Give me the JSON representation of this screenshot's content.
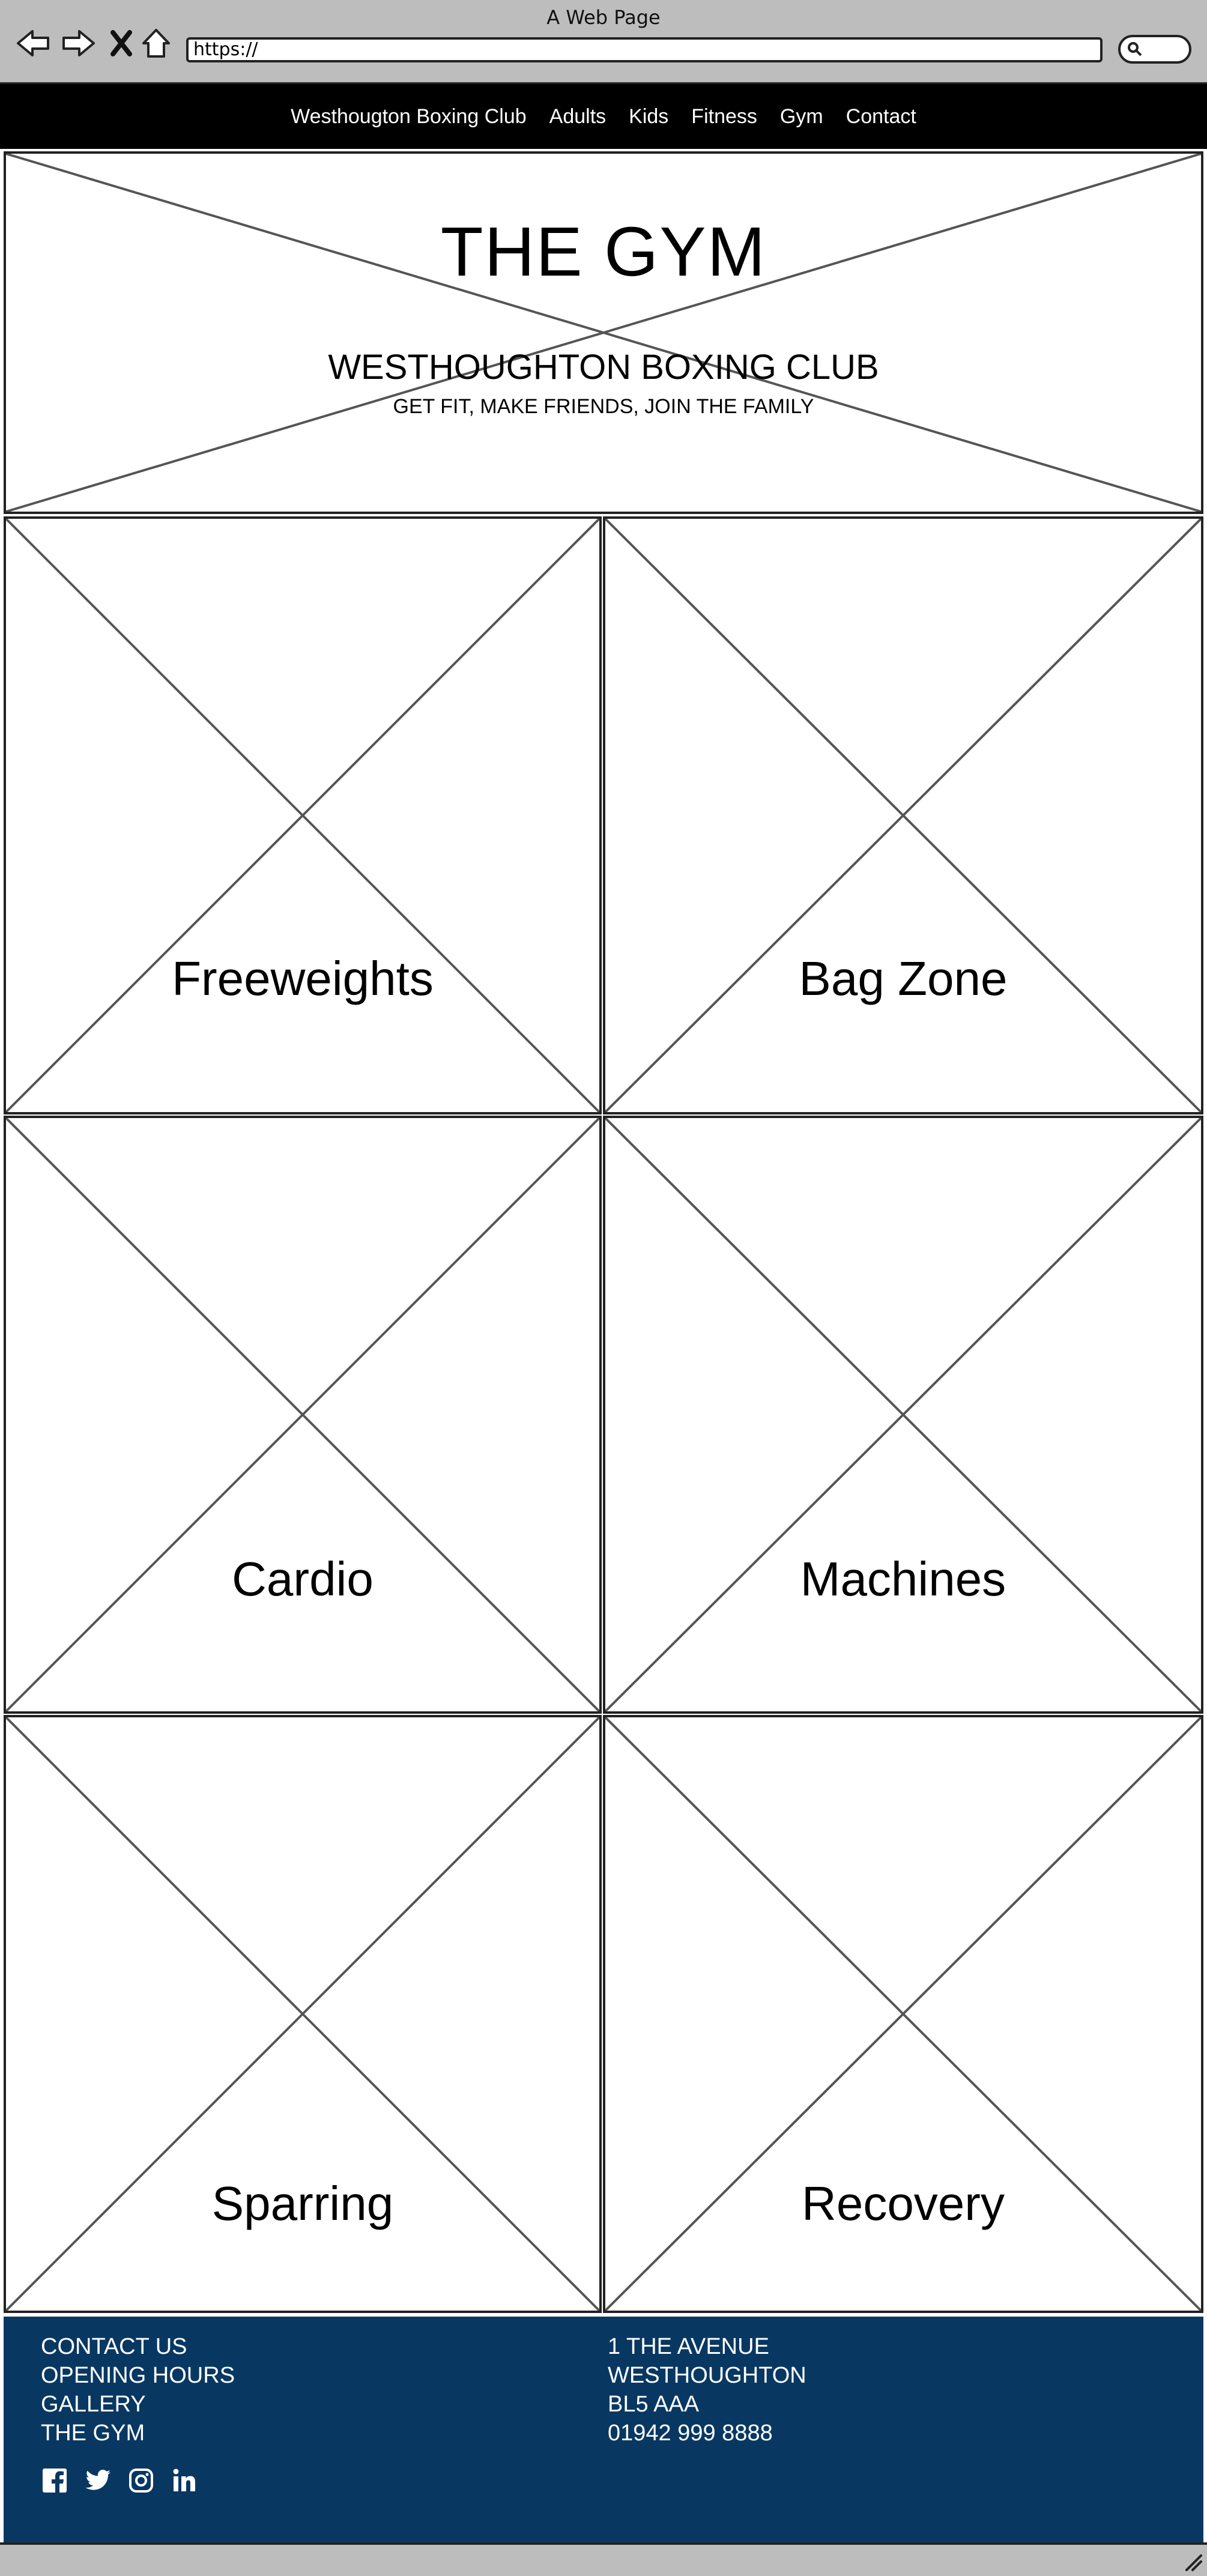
{
  "window": {
    "title": "A Web Page",
    "url": "https://"
  },
  "nav": {
    "items": [
      "Westhougton Boxing Club",
      "Adults",
      "Kids",
      "Fitness",
      "Gym",
      "Contact"
    ]
  },
  "hero": {
    "title": "THE GYM",
    "subtitle": "WESTHOUGHTON BOXING CLUB",
    "tagline": "GET FIT, MAKE FRIENDS, JOIN THE FAMILY"
  },
  "tiles": [
    {
      "label": "Freeweights"
    },
    {
      "label": "Bag Zone"
    },
    {
      "label": "Cardio"
    },
    {
      "label": "Machines"
    },
    {
      "label": "Sparring"
    },
    {
      "label": "Recovery"
    }
  ],
  "footer": {
    "links": [
      "CONTACT US",
      "OPENING HOURS",
      "GALLERY",
      "THE GYM"
    ],
    "address": [
      "1 THE AVENUE",
      "WESTHOUGHTON",
      "BL5 AAA",
      "01942 999 8888"
    ],
    "social_icons": [
      "facebook-icon",
      "twitter-icon",
      "instagram-icon",
      "linkedin-icon"
    ]
  },
  "colors": {
    "nav_bg": "#000000",
    "footer_bg": "#083862",
    "chrome_bg": "#bdbdbd"
  }
}
